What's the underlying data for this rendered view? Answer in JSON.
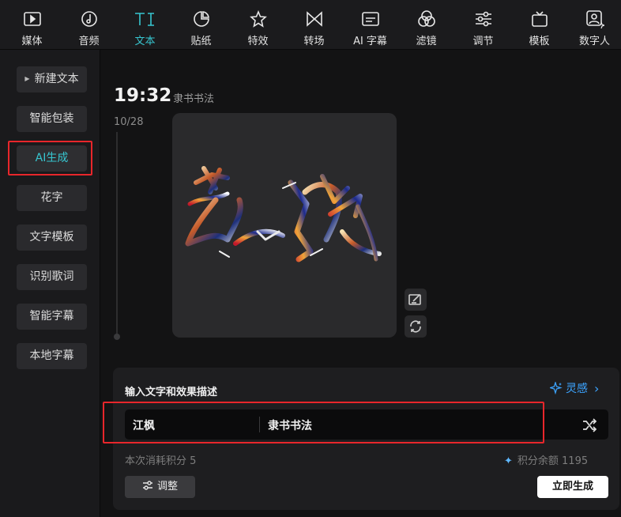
{
  "tabs": [
    {
      "label": "媒体",
      "icon": "media-icon"
    },
    {
      "label": "音频",
      "icon": "audio-icon"
    },
    {
      "label": "文本",
      "icon": "text-icon",
      "active": true
    },
    {
      "label": "贴纸",
      "icon": "sticker-icon"
    },
    {
      "label": "特效",
      "icon": "effects-icon"
    },
    {
      "label": "转场",
      "icon": "transition-icon"
    },
    {
      "label": "AI 字幕",
      "icon": "ai-caption-icon"
    },
    {
      "label": "滤镜",
      "icon": "filter-icon"
    },
    {
      "label": "调节",
      "icon": "adjust-icon"
    },
    {
      "label": "模板",
      "icon": "template-icon"
    },
    {
      "label": "数字人",
      "icon": "digital-human-icon"
    }
  ],
  "sidebar": {
    "items": [
      {
        "label": "新建文本"
      },
      {
        "label": "智能包装"
      },
      {
        "label": "AI生成",
        "active": true
      },
      {
        "label": "花字"
      },
      {
        "label": "文字模板"
      },
      {
        "label": "识别歌词"
      },
      {
        "label": "智能字幕"
      },
      {
        "label": "本地字幕"
      }
    ]
  },
  "result": {
    "time": "19:32",
    "style": "隶书书法",
    "count": "10/28",
    "image": "generated-calligraphy-artwork"
  },
  "panel": {
    "title": "输入文字和效果描述",
    "inspire": "灵感",
    "text_value": "江枫",
    "style_value": "隶书书法",
    "cost": "本次消耗积分 5",
    "balance": "积分余额 1195",
    "adjust_label": "调整",
    "generate_label": "立即生成"
  },
  "colors": {
    "accent": "#37c6d0",
    "link": "#3ca4ff",
    "highlight": "#e8262b"
  }
}
